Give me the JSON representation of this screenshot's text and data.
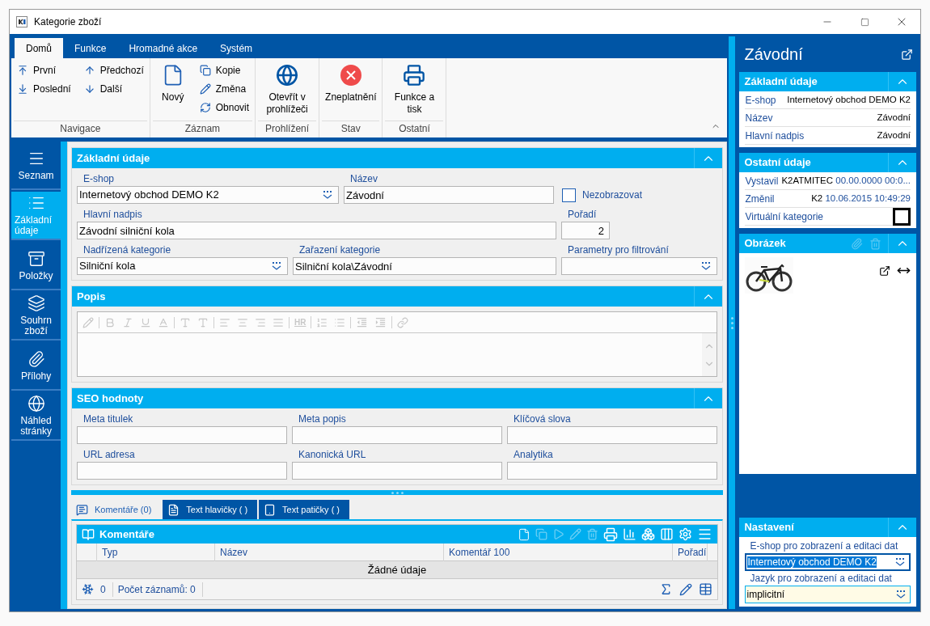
{
  "window": {
    "title": "Kategorie zboží"
  },
  "ribbon": {
    "tabs": [
      {
        "label": "Domů",
        "selected": true
      },
      {
        "label": "Funkce",
        "selected": false
      },
      {
        "label": "Hromadné akce",
        "selected": false
      },
      {
        "label": "Systém",
        "selected": false
      }
    ],
    "groups": [
      {
        "label": "Navigace",
        "buttons": [
          {
            "label": "První",
            "kind": "first"
          },
          {
            "label": "Poslední",
            "kind": "last"
          },
          {
            "label": "Předchozí",
            "kind": "prev"
          },
          {
            "label": "Další",
            "kind": "next"
          }
        ]
      },
      {
        "label": "Záznam",
        "buttons": [
          {
            "label": "Nový",
            "kind": "new"
          },
          {
            "label": "Kopie",
            "kind": "copy"
          },
          {
            "label": "Změna",
            "kind": "edit"
          },
          {
            "label": "Obnovit",
            "kind": "refresh"
          }
        ]
      },
      {
        "label": "Prohlížení",
        "buttons": [
          {
            "label": "Otevřít v prohlížeči",
            "kind": "browser"
          }
        ]
      },
      {
        "label": "Stav",
        "buttons": [
          {
            "label": "Zneplatnění",
            "kind": "invalidate"
          }
        ]
      },
      {
        "label": "Ostatní",
        "buttons": [
          {
            "label": "Funkce a tisk",
            "kind": "print"
          }
        ]
      }
    ]
  },
  "nav": [
    {
      "label": "Seznam",
      "kind": "list",
      "selected": false
    },
    {
      "label": "Základní údaje",
      "kind": "details",
      "selected": true
    },
    {
      "label": "Položky",
      "kind": "items",
      "selected": false
    },
    {
      "label": "Souhrn zboží",
      "kind": "summary",
      "selected": false
    },
    {
      "label": "Přílohy",
      "kind": "attachments",
      "selected": false
    },
    {
      "label": "Náhled stránky",
      "kind": "preview",
      "selected": false
    }
  ],
  "basic": {
    "title": "Základní údaje",
    "rows": [
      [
        {
          "label": "E-shop",
          "kind": "combo",
          "value": "Internetový obchod DEMO K2"
        },
        {
          "label": "Název",
          "kind": "text",
          "value": "Závodní"
        },
        {
          "label": "Nezobrazovat",
          "kind": "checkbox",
          "checked": false
        }
      ],
      [
        {
          "label": "Hlavní nadpis",
          "kind": "text",
          "value": "Závodní silniční kola"
        },
        {
          "label": "Pořadí",
          "kind": "number",
          "value": "2"
        }
      ],
      [
        {
          "label": "Nadřízená kategorie",
          "kind": "combo",
          "value": "Silniční kola"
        },
        {
          "label": "Zařazení kategorie",
          "kind": "text",
          "value": "Silniční kola\\Závodní"
        },
        {
          "label": "Parametry pro filtrování",
          "kind": "combo"
        }
      ]
    ]
  },
  "description": {
    "title": "Popis",
    "toolbar_text": "HR"
  },
  "seo": {
    "title": "SEO hodnoty",
    "fields": [
      {
        "label": "Meta titulek"
      },
      {
        "label": "Meta popis"
      },
      {
        "label": "Klíčová slova"
      },
      {
        "label": "URL adresa"
      },
      {
        "label": "Kanonická URL"
      },
      {
        "label": "Analytika"
      }
    ]
  },
  "bottom_tabs": [
    {
      "label": "Komentáře (0)",
      "kind": "comments",
      "selected": true
    },
    {
      "label": "Text hlavičky ( )",
      "kind": "header",
      "selected": false
    },
    {
      "label": "Text patičky ( )",
      "kind": "footer",
      "selected": false
    }
  ],
  "comments": {
    "title": "Komentáře",
    "columns": [
      "Typ",
      "Název",
      "Komentář 100",
      "Pořadí"
    ],
    "empty": "Žádné údaje",
    "footer_count": "0",
    "footer_records": "Počet záznamů: 0"
  },
  "side": {
    "title": "Závodní",
    "sections": [
      {
        "title": "Základní údaje",
        "rows": [
          {
            "label": "E-shop",
            "value": "Internetový obchod DEMO K2"
          },
          {
            "label": "Název",
            "value": "Závodní"
          },
          {
            "label": "Hlavní nadpis",
            "value": "Závodní"
          }
        ]
      },
      {
        "title": "Ostatní údaje",
        "rows": [
          {
            "label": "Vystavil",
            "value": "K2ATMITEC",
            "date": "00.00.0000 00:0..."
          },
          {
            "label": "Změnil",
            "value": "K2",
            "date": "10.06.2015 10:49:29"
          },
          {
            "label": "Virtuální kategorie",
            "kind": "checkbox",
            "checked": false
          }
        ]
      }
    ],
    "image": {
      "title": "Obrázek"
    },
    "settings": {
      "title": "Nastavení",
      "fields": [
        {
          "label": "E-shop pro zobrazení a editaci dat",
          "value": "Internetový obchod DEMO K2",
          "focused": true
        },
        {
          "label": "Jazyk pro zobrazení a editaci dat",
          "value": "implicitní",
          "focused": false
        }
      ]
    }
  }
}
